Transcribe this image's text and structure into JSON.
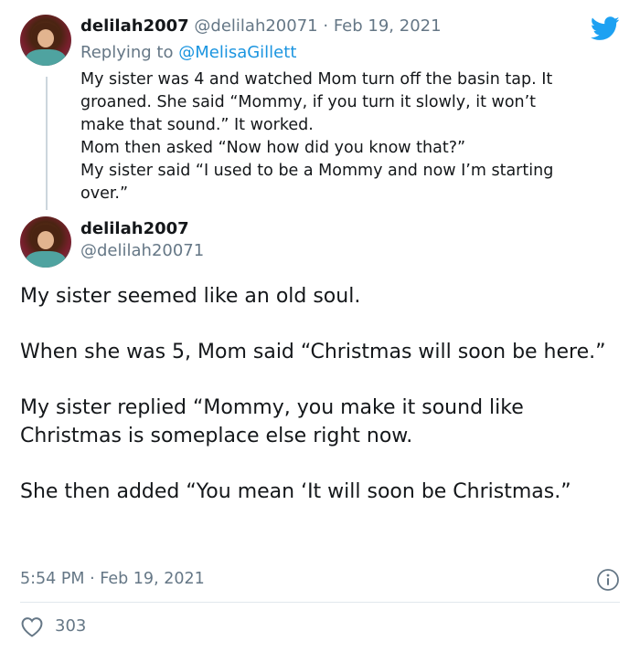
{
  "reply_tweet": {
    "display_name": "delilah2007",
    "handle": "@delilah20071",
    "separator": "·",
    "date": "Feb 19, 2021",
    "replying_prefix": "Replying to",
    "replying_to": "@MelisaGillett",
    "text": "My sister was 4 and  watched Mom turn off the basin tap. It\ngroaned. She said “Mommy, if you turn it slowly,  it won’t\nmake that sound.”  It worked.\nMom then asked “Now how did you know that?”\nMy sister said “I used to be a Mommy and now I’m starting\nover.”"
  },
  "main_tweet": {
    "display_name": "delilah2007",
    "handle": "@delilah20071",
    "paragraphs": [
      "My sister seemed like an old soul.",
      "When she was 5, Mom said “Christmas will soon be here.”",
      "My sister replied “Mommy, you make it sound like Christmas is someplace else right now.",
      "She then added “You mean ‘It will soon be Christmas.”"
    ],
    "time": "5:54 PM",
    "separator": "·",
    "date": "Feb 19, 2021",
    "like_count": "303"
  },
  "icons": {
    "brand": "twitter-bird-icon",
    "info": "info-icon",
    "like": "heart-icon"
  },
  "colors": {
    "brand_blue": "#1DA1F2",
    "link_blue": "#1B95E0",
    "secondary_text": "#657786",
    "thread_line": "#CCD6DD"
  }
}
